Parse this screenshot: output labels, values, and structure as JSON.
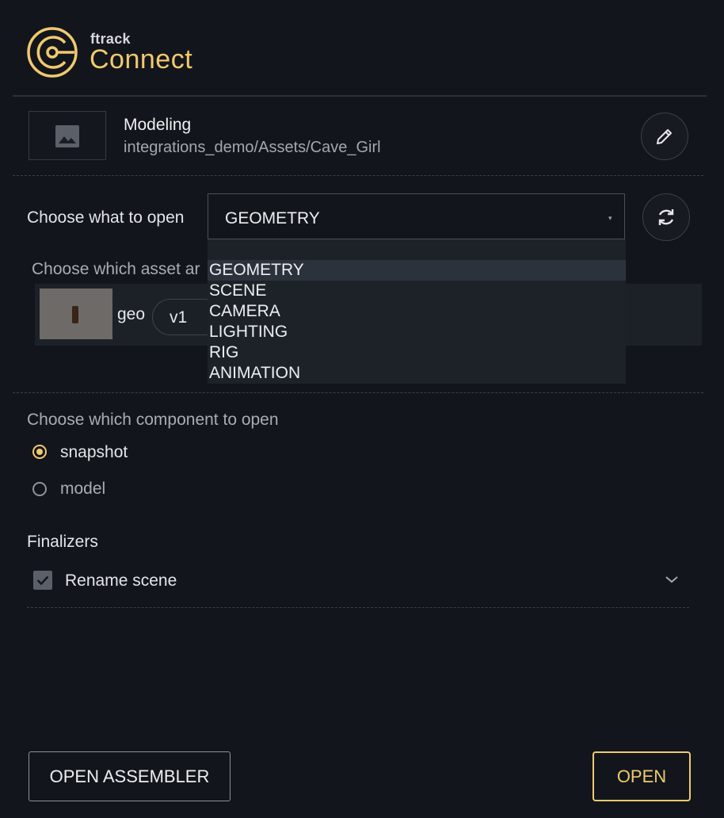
{
  "app": {
    "brand_small": "ftrack",
    "brand_big": "Connect",
    "accent_color": "#f2c96d"
  },
  "context": {
    "name": "Modeling",
    "path": "integrations_demo/Assets/Cave_Girl",
    "thumbnail_icon": "image-placeholder-icon",
    "edit_icon": "pencil-icon"
  },
  "open_selector": {
    "label": "Choose what to open",
    "selected": "GEOMETRY",
    "refresh_icon": "refresh-icon",
    "options": [
      "GEOMETRY",
      "SCENE",
      "CAMERA",
      "LIGHTING",
      "RIG",
      "ANIMATION"
    ]
  },
  "asset_selector": {
    "label": "Choose which asset ar",
    "asset_name": "geo",
    "version": "v1"
  },
  "component_selector": {
    "label": "Choose which component to open",
    "options": [
      {
        "label": "snapshot",
        "selected": true
      },
      {
        "label": "model",
        "selected": false
      }
    ]
  },
  "finalizers": {
    "label": "Finalizers",
    "items": [
      {
        "label": "Rename scene",
        "checked": true
      }
    ]
  },
  "buttons": {
    "assembler": "OPEN ASSEMBLER",
    "open": "OPEN"
  }
}
